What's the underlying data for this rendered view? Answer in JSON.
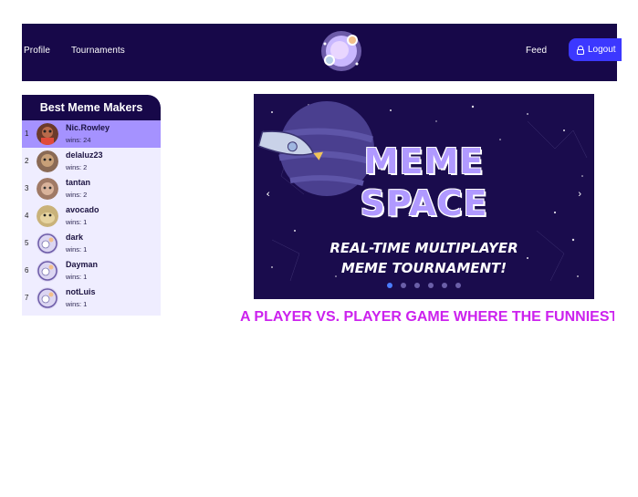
{
  "navbar": {
    "profile_label": "Profile",
    "tournaments_label": "Tournaments",
    "feed_label": "Feed",
    "logout_label": "Logout",
    "logo_icon": "meme-space-logo-icon"
  },
  "leaderboard": {
    "title": "Best Meme Makers",
    "rows": [
      {
        "rank": "1",
        "name": "Nic.Rowley",
        "wins": "wins: 24"
      },
      {
        "rank": "2",
        "name": "delaluz23",
        "wins": "wins: 2"
      },
      {
        "rank": "3",
        "name": "tantan",
        "wins": "wins: 2"
      },
      {
        "rank": "4",
        "name": "avocado",
        "wins": "wins: 1"
      },
      {
        "rank": "5",
        "name": "dark",
        "wins": "wins: 1"
      },
      {
        "rank": "6",
        "name": "Dayman",
        "wins": "wins: 1"
      },
      {
        "rank": "7",
        "name": "notLuis",
        "wins": "wins: 1"
      }
    ]
  },
  "carousel": {
    "title_line1": "MEME",
    "title_line2": "SPACE",
    "tagline_line1": "REAL-TIME MULTIPLAYER",
    "tagline_line2": "MEME TOURNAMENT!",
    "prev_label": "‹",
    "next_label": "›",
    "slide_count": 6,
    "active_slide": 1
  },
  "headline": "A PLAYER VS. PLAYER GAME WHERE THE FUNNIEST",
  "colors": {
    "navbar_bg": "#170849",
    "accent": "#3c38ff",
    "leader_highlight": "#a592ff",
    "headline": "#cc22ee"
  }
}
